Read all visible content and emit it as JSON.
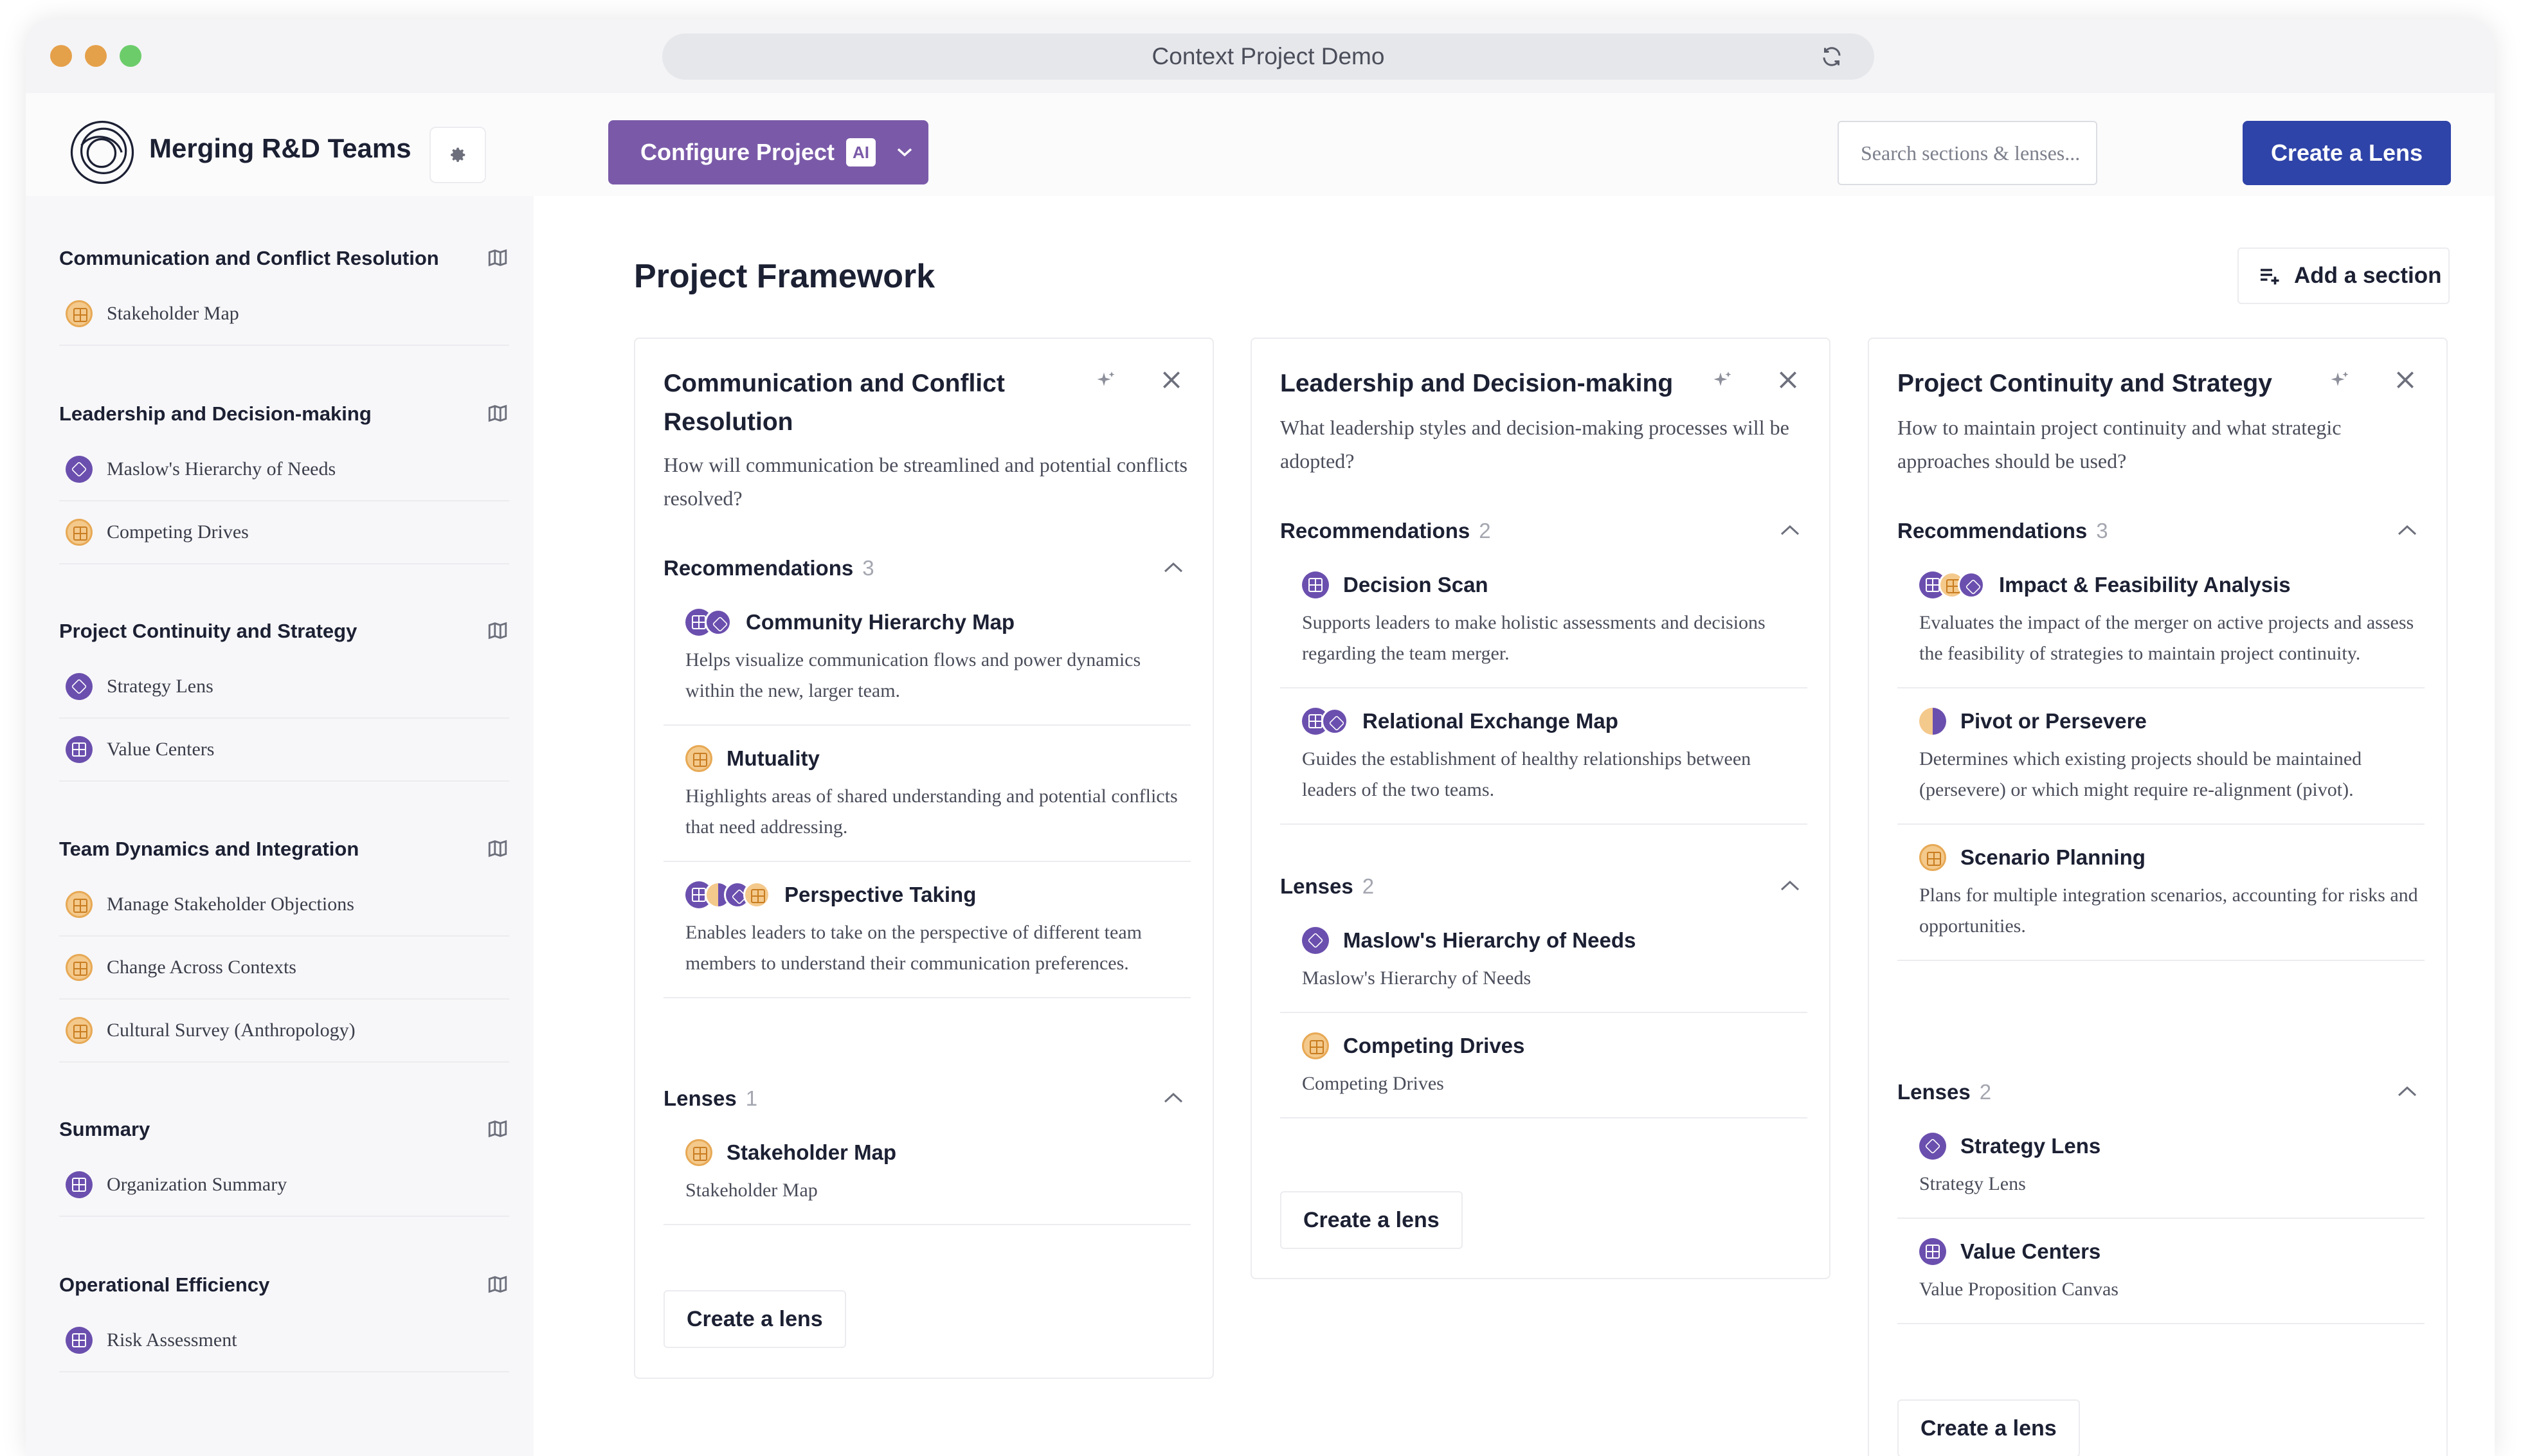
{
  "window": {
    "url_title": "Context Project Demo"
  },
  "header": {
    "brand": "Merging R&D Teams",
    "configure_label": "Configure Project",
    "ai_badge": "AI",
    "search_placeholder": "Search sections & lenses...",
    "create_lens_label": "Create a Lens"
  },
  "sidebar": {
    "sections": [
      {
        "title": "Communication and Conflict Resolution",
        "items": [
          {
            "label": "Stakeholder Map",
            "icon": "grid-lens-icon-orange"
          }
        ]
      },
      {
        "title": "Leadership and Decision-making",
        "items": [
          {
            "label": "Maslow's Hierarchy of Needs",
            "icon": "layers-lens-icon-purple"
          },
          {
            "label": "Competing Drives",
            "icon": "grid-lens-icon-orange"
          }
        ]
      },
      {
        "title": "Project Continuity and Strategy",
        "items": [
          {
            "label": "Strategy Lens",
            "icon": "layers-lens-icon-purple"
          },
          {
            "label": "Value Centers",
            "icon": "grid-lens-icon-purple"
          }
        ]
      },
      {
        "title": "Team Dynamics and Integration",
        "items": [
          {
            "label": "Manage Stakeholder Objections",
            "icon": "grid-lens-icon-orange"
          },
          {
            "label": "Change Across Contexts",
            "icon": "grid-lens-icon-orange"
          },
          {
            "label": "Cultural Survey (Anthropology)",
            "icon": "grid-lens-icon-orange"
          }
        ]
      },
      {
        "title": "Summary",
        "items": [
          {
            "label": "Organization Summary",
            "icon": "grid-lens-icon-purple"
          }
        ]
      },
      {
        "title": "Operational Efficiency",
        "items": [
          {
            "label": "Risk Assessment",
            "icon": "grid-lens-icon-purple"
          }
        ]
      }
    ]
  },
  "main": {
    "title": "Project Framework",
    "add_section_label": "Add a section",
    "create_lens_small": "Create a lens",
    "cards": [
      {
        "title": "Communication and Conflict Resolution",
        "description": "How will communication be streamlined and potential conflicts resolved?",
        "recommendations_label": "Recommendations",
        "recommendations_count": "3",
        "recommendations": [
          {
            "title": "Community Hierarchy Map",
            "description": "Helps visualize communication flows and power dynamics within the new, larger team."
          },
          {
            "title": "Mutuality",
            "description": "Highlights areas of shared understanding and potential conflicts that need addressing."
          },
          {
            "title": "Perspective Taking",
            "description": "Enables leaders to take on the perspective of different team members to understand their communication preferences."
          }
        ],
        "lenses_label": "Lenses",
        "lenses_count": "1",
        "lenses": [
          {
            "title": "Stakeholder Map",
            "description": "Stakeholder Map"
          }
        ]
      },
      {
        "title": "Leadership and Decision-making",
        "description": "What leadership styles and decision-making processes will be adopted?",
        "recommendations_label": "Recommendations",
        "recommendations_count": "2",
        "recommendations": [
          {
            "title": "Decision Scan",
            "description": "Supports leaders to make holistic assessments and decisions regarding the team merger."
          },
          {
            "title": "Relational Exchange Map",
            "description": "Guides the establishment of healthy relationships between leaders of the two teams."
          }
        ],
        "lenses_label": "Lenses",
        "lenses_count": "2",
        "lenses": [
          {
            "title": "Maslow's Hierarchy of Needs",
            "description": "Maslow's Hierarchy of Needs"
          },
          {
            "title": "Competing Drives",
            "description": "Competing Drives"
          }
        ]
      },
      {
        "title": "Project Continuity and Strategy",
        "description": "How to maintain project continuity and what strategic approaches should be used?",
        "recommendations_label": "Recommendations",
        "recommendations_count": "3",
        "recommendations": [
          {
            "title": "Impact & Feasibility Analysis",
            "description": "Evaluates the impact of the merger on active projects and assess the feasibility of strategies to maintain project continuity."
          },
          {
            "title": "Pivot or Persevere",
            "description": "Determines which existing projects should be maintained (persevere) or which might require re-alignment (pivot)."
          },
          {
            "title": "Scenario Planning",
            "description": "Plans for multiple integration scenarios, accounting for risks and opportunities."
          }
        ],
        "lenses_label": "Lenses",
        "lenses_count": "2",
        "lenses": [
          {
            "title": "Strategy Lens",
            "description": "Strategy Lens"
          },
          {
            "title": "Value Centers",
            "description": "Value Proposition Canvas"
          }
        ]
      }
    ]
  },
  "colors": {
    "accent_purple": "#7a5aa8",
    "primary_blue": "#2f44a8",
    "lens_orange": "#f4c98c",
    "lens_purple": "#6b4fae"
  }
}
